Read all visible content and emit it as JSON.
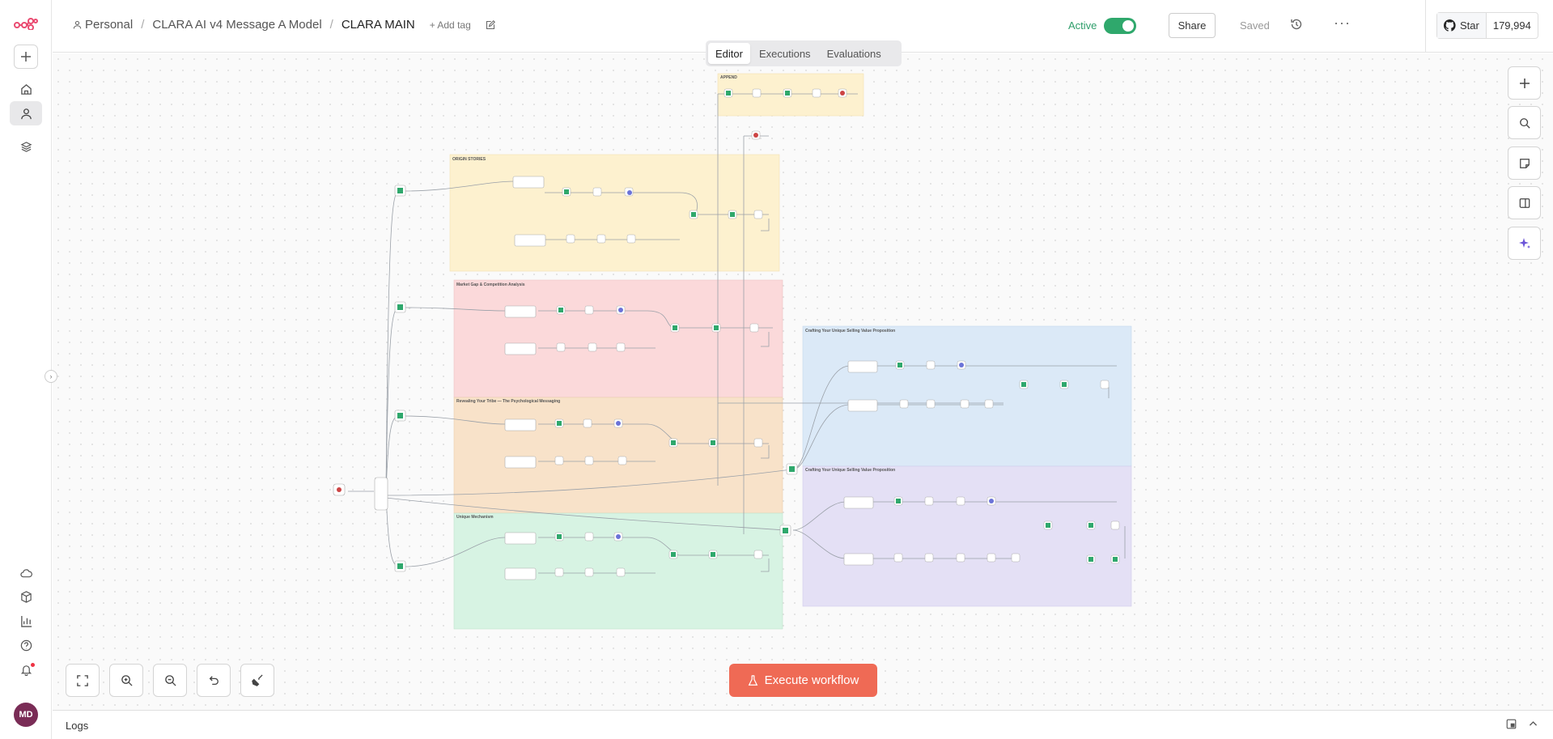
{
  "header": {
    "breadcrumb": [
      "Personal",
      "CLARA AI v4 Message A Model",
      "CLARA MAIN"
    ],
    "add_tag": "+ Add tag",
    "active_label": "Active",
    "share": "Share",
    "saved": "Saved",
    "github_star": "Star",
    "github_count": "179,994"
  },
  "tabs": [
    {
      "label": "Editor",
      "selected": true
    },
    {
      "label": "Executions",
      "selected": false
    },
    {
      "label": "Evaluations",
      "selected": false
    }
  ],
  "canvas": {
    "stickies": [
      {
        "title": "APPEND",
        "color": "#fdf1cf"
      },
      {
        "title": "ORIGIN STORIES",
        "color": "#fdf1cf"
      },
      {
        "title": "Market Gap & Competition Analysis",
        "color": "#fbd9da"
      },
      {
        "title": "Revealing Your Tribe — The Psychological Messaging",
        "color": "#f8e2c9"
      },
      {
        "title": "Unique Mechanism",
        "color": "#d7f3e3"
      },
      {
        "title": "Crafting Your Unique Selling Value Proposition",
        "color": "#dbe9f7"
      },
      {
        "title": "Crafting Your Unique Selling Value Proposition",
        "color": "#e4e0f5"
      }
    ]
  },
  "execute_label": "Execute workflow",
  "logs_label": "Logs",
  "user_initials": "MD",
  "icons": {
    "logo": "n8n-logo-icon",
    "create": "plus-icon",
    "home": "home-icon",
    "personal": "user-icon",
    "projects": "layers-icon",
    "cloud": "cloud-icon",
    "templates": "box-icon",
    "insights": "bar-chart-icon",
    "help": "help-icon",
    "notifications": "bell-icon"
  },
  "colors": {
    "accent": "#ef6a55",
    "active_green": "#2fa86c"
  }
}
